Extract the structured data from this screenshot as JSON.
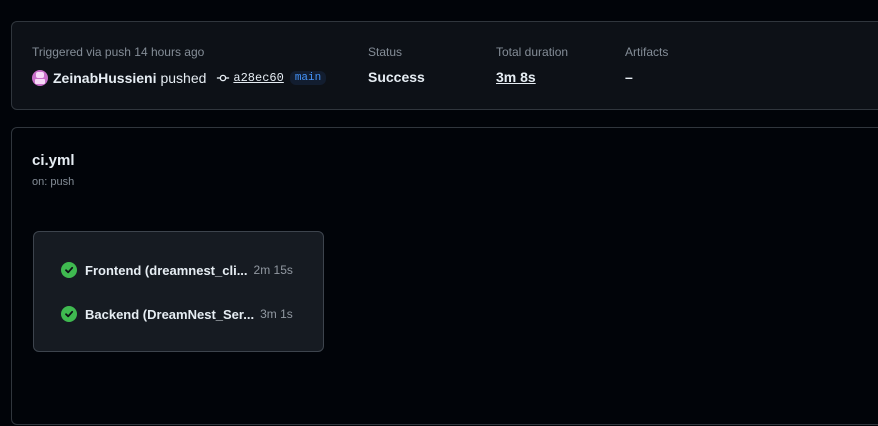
{
  "summary": {
    "trigger_text": "Triggered via push 14 hours ago",
    "actor": "ZeinabHussieni",
    "action": "pushed",
    "commit_sha": "a28ec60",
    "branch": "main",
    "status_label": "Status",
    "status_value": "Success",
    "duration_label": "Total duration",
    "duration_value": "3m 8s",
    "artifacts_label": "Artifacts",
    "artifacts_value": "–"
  },
  "workflow": {
    "file": "ci.yml",
    "trigger": "on: push",
    "jobs": [
      {
        "name": "Frontend (dreamnest_cli...",
        "duration": "2m 15s",
        "status": "success"
      },
      {
        "name": "Backend (DreamNest_Ser...",
        "duration": "3m 1s",
        "status": "success"
      }
    ]
  },
  "colors": {
    "success": "#3fb950",
    "branch_text": "#4493f8",
    "background": "#010409"
  },
  "icons": {
    "avatar": "user-avatar",
    "commit": "git-commit-icon",
    "job_status": "check-circle-icon"
  }
}
